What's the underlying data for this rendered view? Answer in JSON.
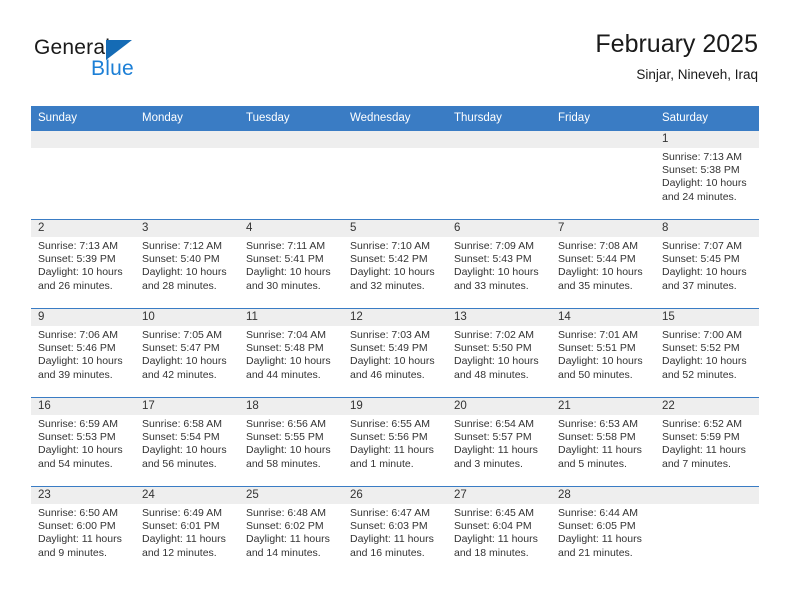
{
  "brand": {
    "name_part1": "General",
    "name_part2": "Blue",
    "accent_color": "#1c7fd6",
    "triangle_color": "#156bb5"
  },
  "header": {
    "title": "February 2025",
    "subtitle": "Sinjar, Nineveh, Iraq"
  },
  "calendar": {
    "header_bg": "#3a7cc4",
    "daynum_bg": "#eeeeee",
    "weekdays": [
      "Sunday",
      "Monday",
      "Tuesday",
      "Wednesday",
      "Thursday",
      "Friday",
      "Saturday"
    ],
    "weeks": [
      [
        {
          "day": "",
          "lines": []
        },
        {
          "day": "",
          "lines": []
        },
        {
          "day": "",
          "lines": []
        },
        {
          "day": "",
          "lines": []
        },
        {
          "day": "",
          "lines": []
        },
        {
          "day": "",
          "lines": []
        },
        {
          "day": "1",
          "lines": [
            "Sunrise: 7:13 AM",
            "Sunset: 5:38 PM",
            "Daylight: 10 hours",
            "and 24 minutes."
          ]
        }
      ],
      [
        {
          "day": "2",
          "lines": [
            "Sunrise: 7:13 AM",
            "Sunset: 5:39 PM",
            "Daylight: 10 hours",
            "and 26 minutes."
          ]
        },
        {
          "day": "3",
          "lines": [
            "Sunrise: 7:12 AM",
            "Sunset: 5:40 PM",
            "Daylight: 10 hours",
            "and 28 minutes."
          ]
        },
        {
          "day": "4",
          "lines": [
            "Sunrise: 7:11 AM",
            "Sunset: 5:41 PM",
            "Daylight: 10 hours",
            "and 30 minutes."
          ]
        },
        {
          "day": "5",
          "lines": [
            "Sunrise: 7:10 AM",
            "Sunset: 5:42 PM",
            "Daylight: 10 hours",
            "and 32 minutes."
          ]
        },
        {
          "day": "6",
          "lines": [
            "Sunrise: 7:09 AM",
            "Sunset: 5:43 PM",
            "Daylight: 10 hours",
            "and 33 minutes."
          ]
        },
        {
          "day": "7",
          "lines": [
            "Sunrise: 7:08 AM",
            "Sunset: 5:44 PM",
            "Daylight: 10 hours",
            "and 35 minutes."
          ]
        },
        {
          "day": "8",
          "lines": [
            "Sunrise: 7:07 AM",
            "Sunset: 5:45 PM",
            "Daylight: 10 hours",
            "and 37 minutes."
          ]
        }
      ],
      [
        {
          "day": "9",
          "lines": [
            "Sunrise: 7:06 AM",
            "Sunset: 5:46 PM",
            "Daylight: 10 hours",
            "and 39 minutes."
          ]
        },
        {
          "day": "10",
          "lines": [
            "Sunrise: 7:05 AM",
            "Sunset: 5:47 PM",
            "Daylight: 10 hours",
            "and 42 minutes."
          ]
        },
        {
          "day": "11",
          "lines": [
            "Sunrise: 7:04 AM",
            "Sunset: 5:48 PM",
            "Daylight: 10 hours",
            "and 44 minutes."
          ]
        },
        {
          "day": "12",
          "lines": [
            "Sunrise: 7:03 AM",
            "Sunset: 5:49 PM",
            "Daylight: 10 hours",
            "and 46 minutes."
          ]
        },
        {
          "day": "13",
          "lines": [
            "Sunrise: 7:02 AM",
            "Sunset: 5:50 PM",
            "Daylight: 10 hours",
            "and 48 minutes."
          ]
        },
        {
          "day": "14",
          "lines": [
            "Sunrise: 7:01 AM",
            "Sunset: 5:51 PM",
            "Daylight: 10 hours",
            "and 50 minutes."
          ]
        },
        {
          "day": "15",
          "lines": [
            "Sunrise: 7:00 AM",
            "Sunset: 5:52 PM",
            "Daylight: 10 hours",
            "and 52 minutes."
          ]
        }
      ],
      [
        {
          "day": "16",
          "lines": [
            "Sunrise: 6:59 AM",
            "Sunset: 5:53 PM",
            "Daylight: 10 hours",
            "and 54 minutes."
          ]
        },
        {
          "day": "17",
          "lines": [
            "Sunrise: 6:58 AM",
            "Sunset: 5:54 PM",
            "Daylight: 10 hours",
            "and 56 minutes."
          ]
        },
        {
          "day": "18",
          "lines": [
            "Sunrise: 6:56 AM",
            "Sunset: 5:55 PM",
            "Daylight: 10 hours",
            "and 58 minutes."
          ]
        },
        {
          "day": "19",
          "lines": [
            "Sunrise: 6:55 AM",
            "Sunset: 5:56 PM",
            "Daylight: 11 hours",
            "and 1 minute."
          ]
        },
        {
          "day": "20",
          "lines": [
            "Sunrise: 6:54 AM",
            "Sunset: 5:57 PM",
            "Daylight: 11 hours",
            "and 3 minutes."
          ]
        },
        {
          "day": "21",
          "lines": [
            "Sunrise: 6:53 AM",
            "Sunset: 5:58 PM",
            "Daylight: 11 hours",
            "and 5 minutes."
          ]
        },
        {
          "day": "22",
          "lines": [
            "Sunrise: 6:52 AM",
            "Sunset: 5:59 PM",
            "Daylight: 11 hours",
            "and 7 minutes."
          ]
        }
      ],
      [
        {
          "day": "23",
          "lines": [
            "Sunrise: 6:50 AM",
            "Sunset: 6:00 PM",
            "Daylight: 11 hours",
            "and 9 minutes."
          ]
        },
        {
          "day": "24",
          "lines": [
            "Sunrise: 6:49 AM",
            "Sunset: 6:01 PM",
            "Daylight: 11 hours",
            "and 12 minutes."
          ]
        },
        {
          "day": "25",
          "lines": [
            "Sunrise: 6:48 AM",
            "Sunset: 6:02 PM",
            "Daylight: 11 hours",
            "and 14 minutes."
          ]
        },
        {
          "day": "26",
          "lines": [
            "Sunrise: 6:47 AM",
            "Sunset: 6:03 PM",
            "Daylight: 11 hours",
            "and 16 minutes."
          ]
        },
        {
          "day": "27",
          "lines": [
            "Sunrise: 6:45 AM",
            "Sunset: 6:04 PM",
            "Daylight: 11 hours",
            "and 18 minutes."
          ]
        },
        {
          "day": "28",
          "lines": [
            "Sunrise: 6:44 AM",
            "Sunset: 6:05 PM",
            "Daylight: 11 hours",
            "and 21 minutes."
          ]
        },
        {
          "day": "",
          "lines": []
        }
      ]
    ]
  }
}
